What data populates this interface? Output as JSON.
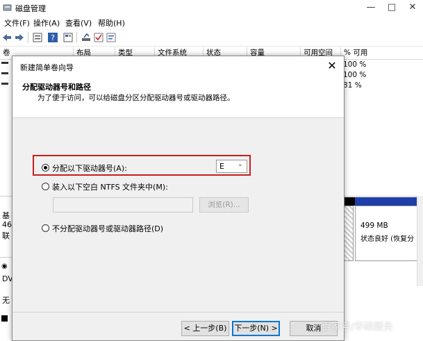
{
  "window": {
    "title": "磁盘管理",
    "menu": [
      "文件(F)",
      "操作(A)",
      "查看(V)",
      "帮助(H)"
    ]
  },
  "volume_table": {
    "headers": [
      "卷",
      "布局",
      "类型",
      "文件系统",
      "状态",
      "容量",
      "可用空间",
      "% 可用"
    ],
    "rows_percent": [
      "100 %",
      "100 %",
      "81 %"
    ]
  },
  "disk_panel": {
    "left_labels": [
      "基",
      "46",
      "联",
      "DV",
      "无"
    ],
    "partition_size": "499 MB",
    "partition_status": "状态良好 (恢复分"
  },
  "dialog": {
    "title": "新建简单卷向导",
    "heading": "分配驱动器号和路径",
    "subheading": "为了便于访问，可以给磁盘分区分配驱动器号或驱动器路径。",
    "option_assign": "分配以下驱动器号(A):",
    "drive_letter": "E",
    "option_mount": "装入以下空白 NTFS 文件夹中(M):",
    "browse": "浏览(R)...",
    "option_none": "不分配驱动器号或驱动器路径(D)",
    "btn_back": "< 上一步(B)",
    "btn_next": "下一步(N) >",
    "btn_cancel": "取消"
  },
  "watermark": "百家号/华硕服务",
  "colors": {
    "highlight": "#c81e1e",
    "disk_blue": "#1e3ea8",
    "focus": "#0078d7"
  }
}
